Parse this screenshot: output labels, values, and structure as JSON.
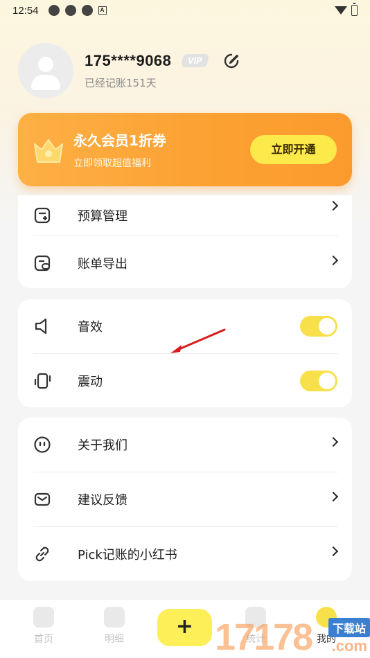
{
  "status_bar": {
    "time": "12:54",
    "badge": "A"
  },
  "profile": {
    "phone": "175****9068",
    "vip_label": "VIP",
    "days_text": "已经记账151天"
  },
  "promo": {
    "title": "永久会员1折券",
    "subtitle": "立即领取超值福利",
    "button": "立即开通",
    "accent": "#fca133"
  },
  "menu_group1": [
    {
      "label": "预算管理",
      "icon": "budget-icon"
    },
    {
      "label": "账单导出",
      "icon": "export-icon"
    }
  ],
  "menu_group2": [
    {
      "label": "音效",
      "icon": "speaker-icon",
      "enabled": true
    },
    {
      "label": "震动",
      "icon": "vibrate-icon",
      "enabled": true
    }
  ],
  "menu_group3": [
    {
      "label": "关于我们",
      "icon": "smiley-icon"
    },
    {
      "label": "建议反馈",
      "icon": "mail-icon"
    },
    {
      "label": "Pick记账的小红书",
      "icon": "link-icon"
    }
  ],
  "tabbar": {
    "home": "首页",
    "detail": "明细",
    "add": "+",
    "stats": "统计",
    "mine": "我的"
  },
  "watermark": {
    "number": "17178",
    "tag": "下载站",
    "domain": ".com"
  },
  "colors": {
    "toggle": "#f8e04b",
    "add_button": "#fcef58"
  }
}
